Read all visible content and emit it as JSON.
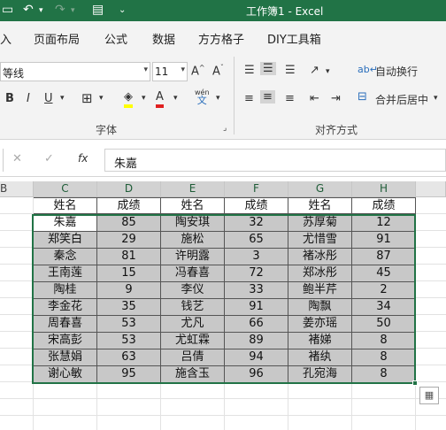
{
  "titlebar": {
    "title": "工作簿1  -  Excel"
  },
  "tabs": [
    "入",
    "页面布局",
    "公式",
    "数据",
    "方方格子",
    "DIY工具箱"
  ],
  "ribbon": {
    "font_name": "等线",
    "font_size": "11",
    "bold": "B",
    "italic": "I",
    "underline": "U",
    "phonetic_top": "wén",
    "phonetic_bottom": "文",
    "wrap_text": "自动换行",
    "merge_center": "合并后居中",
    "group_font": "字体",
    "group_align": "对齐方式"
  },
  "formula": {
    "content": "朱嘉",
    "fx": "fx"
  },
  "columns": [
    "B",
    "C",
    "D",
    "E",
    "F",
    "G",
    "H"
  ],
  "headers": [
    "姓名",
    "成绩",
    "姓名",
    "成绩",
    "姓名",
    "成绩"
  ],
  "rows": [
    [
      "朱嘉",
      "85",
      "陶安琪",
      "32",
      "苏厚菊",
      "12"
    ],
    [
      "郑笑白",
      "29",
      "施松",
      "65",
      "尤惜雪",
      "91"
    ],
    [
      "秦念",
      "81",
      "许明露",
      "3",
      "褚冰彤",
      "87"
    ],
    [
      "王南莲",
      "15",
      "冯春喜",
      "72",
      "郑冰彤",
      "45"
    ],
    [
      "陶桂",
      "9",
      "李仪",
      "33",
      "鲍半芹",
      "2"
    ],
    [
      "李金花",
      "35",
      "钱艺",
      "91",
      "陶飘",
      "34"
    ],
    [
      "周春喜",
      "53",
      "尤凡",
      "66",
      "姜亦瑶",
      "50"
    ],
    [
      "宋高彭",
      "53",
      "尤虹霖",
      "89",
      "褚娣",
      "8"
    ],
    [
      "张慧娟",
      "63",
      "吕倩",
      "94",
      "褚纨",
      "8"
    ],
    [
      "谢心敏",
      "95",
      "施含玉",
      "96",
      "孔宛海",
      "8"
    ]
  ]
}
